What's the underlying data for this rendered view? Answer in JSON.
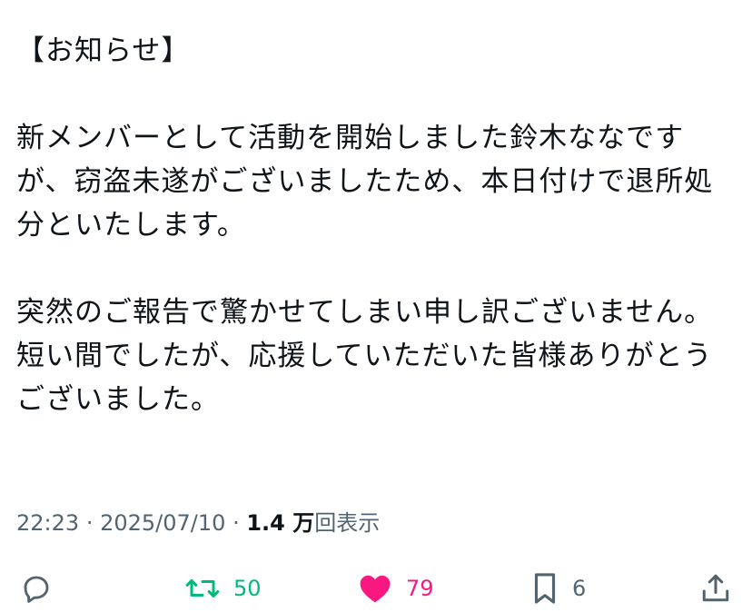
{
  "post": {
    "header": "【お知らせ】",
    "paragraph1": "新メンバーとして活動を開始しました鈴木ななですが、窃盗未遂がございましたため、本日付けで退所処分といたします。",
    "paragraph2": "突然のご報告で驚かせてしまい申し訳ございません。短い間でしたが、応援していただいた皆様ありがとうございました。"
  },
  "meta": {
    "time": "22:23",
    "date": "2025/07/10",
    "separator": "·",
    "views_count": "1.4 万",
    "views_label": "回表示"
  },
  "actions": {
    "reply": {
      "icon": "reply-icon"
    },
    "repost": {
      "icon": "repost-icon",
      "count": "50",
      "color": "#00ba7c"
    },
    "like": {
      "icon": "heart-icon",
      "count": "79",
      "color": "#f91880"
    },
    "bookmark": {
      "icon": "bookmark-icon",
      "count": "6"
    },
    "share": {
      "icon": "share-icon"
    }
  }
}
